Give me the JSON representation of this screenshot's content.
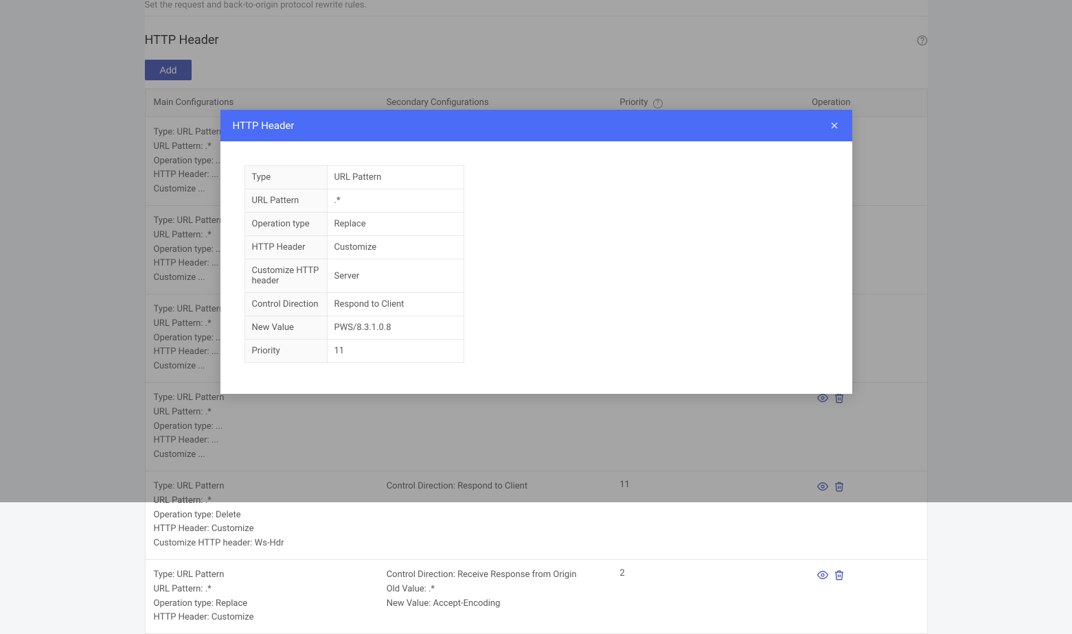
{
  "page": {
    "description": "Set the request and back-to-origin protocol rewrite rules."
  },
  "section": {
    "title": "HTTP Header",
    "add_label": "Add"
  },
  "columns": {
    "main": "Main Configurations",
    "secondary": "Secondary Configurations",
    "priority": "Priority",
    "operation": "Operation"
  },
  "rows": [
    {
      "main": [
        "Type: URL Pattern",
        "URL Pattern: .*",
        "Operation type: ...",
        "HTTP Header: ...",
        "Customize ..."
      ],
      "secondary": [],
      "priority": ""
    },
    {
      "main": [
        "Type: URL Pattern",
        "URL Pattern: .*",
        "Operation type: ...",
        "HTTP Header: ...",
        "Customize ..."
      ],
      "secondary": [],
      "priority": ""
    },
    {
      "main": [
        "Type: URL Pattern",
        "URL Pattern: .*",
        "Operation type: ...",
        "HTTP Header: ...",
        "Customize ..."
      ],
      "secondary": [],
      "priority": ""
    },
    {
      "main": [
        "Type: URL Pattern",
        "URL Pattern: .*",
        "Operation type: ...",
        "HTTP Header: ...",
        "Customize ..."
      ],
      "secondary": [],
      "priority": ""
    },
    {
      "main": [
        "Type: URL Pattern",
        "URL Pattern: .*",
        "Operation type: Delete",
        "HTTP Header: Customize",
        "Customize HTTP header: Ws-Hdr"
      ],
      "secondary": [
        "Control Direction: Respond to Client"
      ],
      "priority": "11"
    },
    {
      "main": [
        "Type: URL Pattern",
        "URL Pattern: .*",
        "Operation type: Replace",
        "HTTP Header: Customize"
      ],
      "secondary": [
        "Control Direction: Receive Response from Origin",
        "Old Value: .*",
        "New Value: Accept-Encoding"
      ],
      "priority": "2"
    }
  ],
  "modal": {
    "title": "HTTP Header",
    "fields": [
      {
        "label": "Type",
        "value": "URL Pattern"
      },
      {
        "label": "URL Pattern",
        "value": ".*"
      },
      {
        "label": "Operation type",
        "value": "Replace"
      },
      {
        "label": "HTTP Header",
        "value": "Customize"
      },
      {
        "label": "Customize HTTP header",
        "value": "Server"
      },
      {
        "label": "Control Direction",
        "value": "Respond to Client"
      },
      {
        "label": "New Value",
        "value": "PWS/8.3.1.0.8"
      },
      {
        "label": "Priority",
        "value": "11"
      }
    ]
  }
}
